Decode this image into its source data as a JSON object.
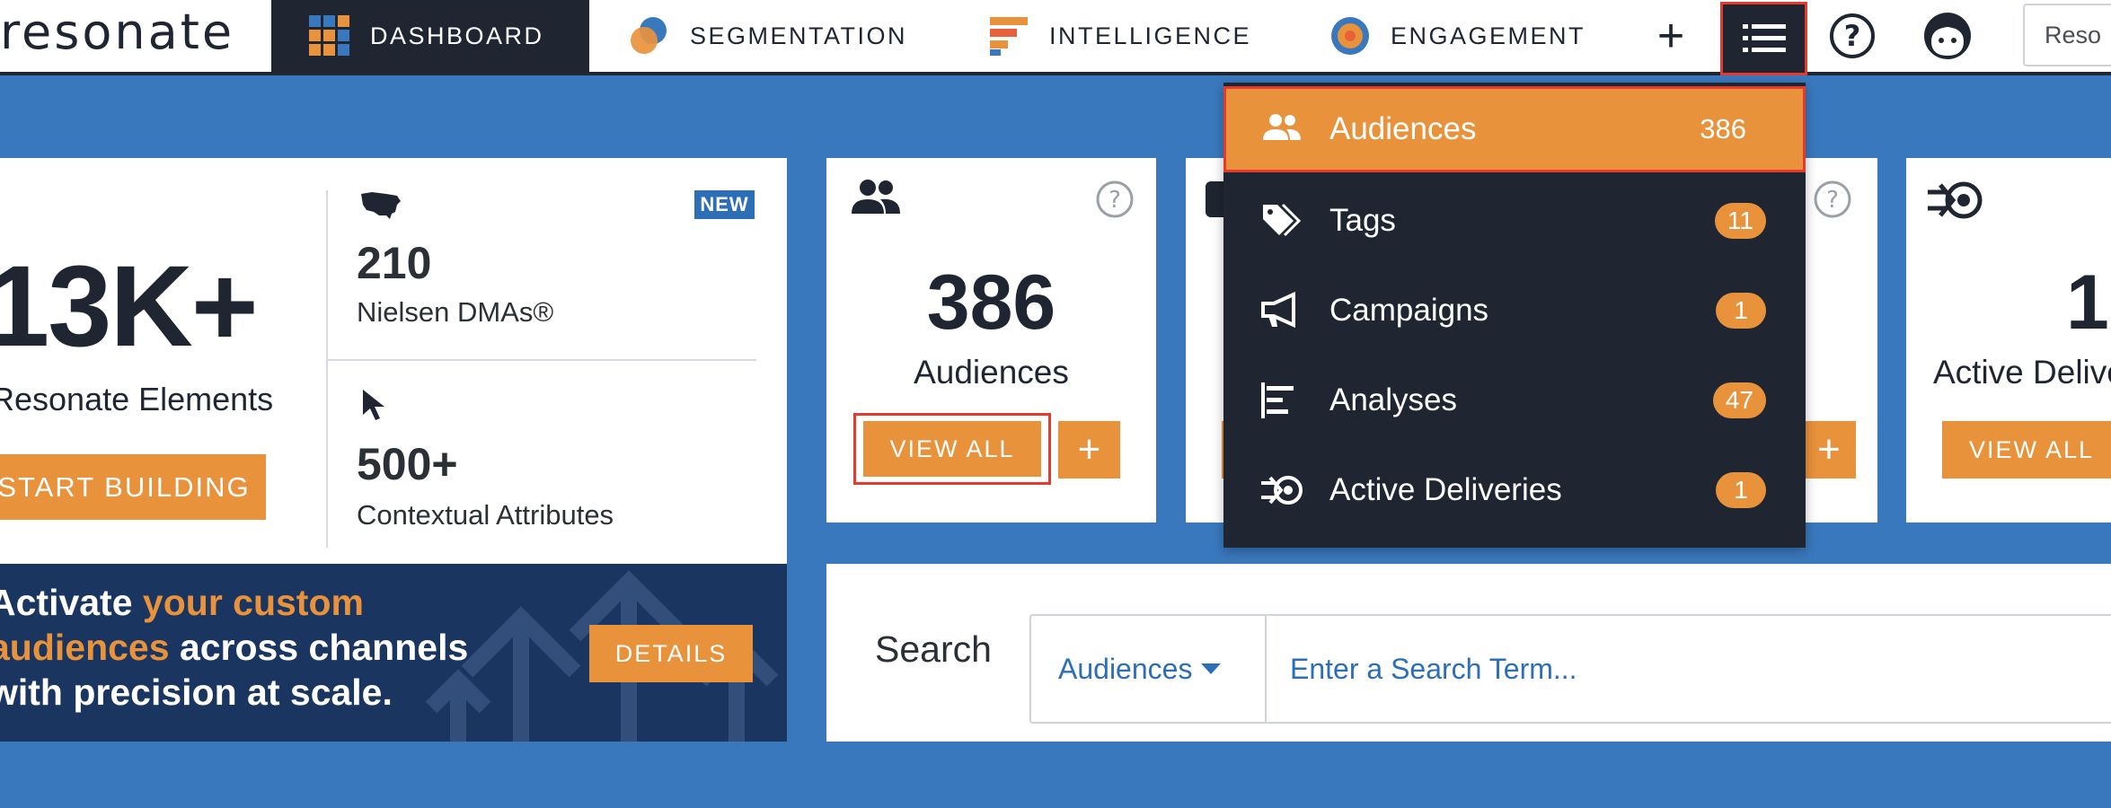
{
  "nav": {
    "logo": "resonate",
    "items": [
      {
        "label": "DASHBOARD",
        "icon": "grid-icon"
      },
      {
        "label": "SEGMENTATION",
        "icon": "venn-icon"
      },
      {
        "label": "INTELLIGENCE",
        "icon": "bars-icon"
      },
      {
        "label": "ENGAGEMENT",
        "icon": "target-icon"
      }
    ],
    "search_text": "Reso"
  },
  "stats": {
    "elements_num": "13K+",
    "elements_label": "Resonate Elements",
    "start_label": "START BUILDING",
    "new_badge": "NEW",
    "dma_num": "210",
    "dma_label": "Nielsen DMAs®",
    "ctx_num": "500+",
    "ctx_label": "Contextual Attributes"
  },
  "banner": {
    "line1_a": "Activate ",
    "line1_b": "your custom",
    "line2_a": "audiences",
    "line2_b": " across channels",
    "line3": "with precision at scale.",
    "details_label": "DETAILS"
  },
  "audiences_card": {
    "count": "386",
    "label": "Audiences",
    "view_all": "VIEW ALL",
    "add": "+"
  },
  "deliveries_card": {
    "count": "1",
    "label": "Active Deliveries",
    "view_all": "VIEW ALL"
  },
  "search": {
    "label": "Search",
    "select_value": "Audiences",
    "placeholder": "Enter a Search Term..."
  },
  "dropdown": {
    "items": [
      {
        "label": "Audiences",
        "count": "386",
        "icon": "people-icon"
      },
      {
        "label": "Tags",
        "count": "11",
        "icon": "tag-icon"
      },
      {
        "label": "Campaigns",
        "count": "1",
        "icon": "megaphone-icon"
      },
      {
        "label": "Analyses",
        "count": "47",
        "icon": "analysis-bars-icon"
      },
      {
        "label": "Active Deliveries",
        "count": "1",
        "icon": "delivery-icon"
      }
    ]
  },
  "colors": {
    "accent": "#e8923c",
    "navy": "#1f2631",
    "blue": "#3a78bd",
    "highlight": "#e53b2e"
  }
}
